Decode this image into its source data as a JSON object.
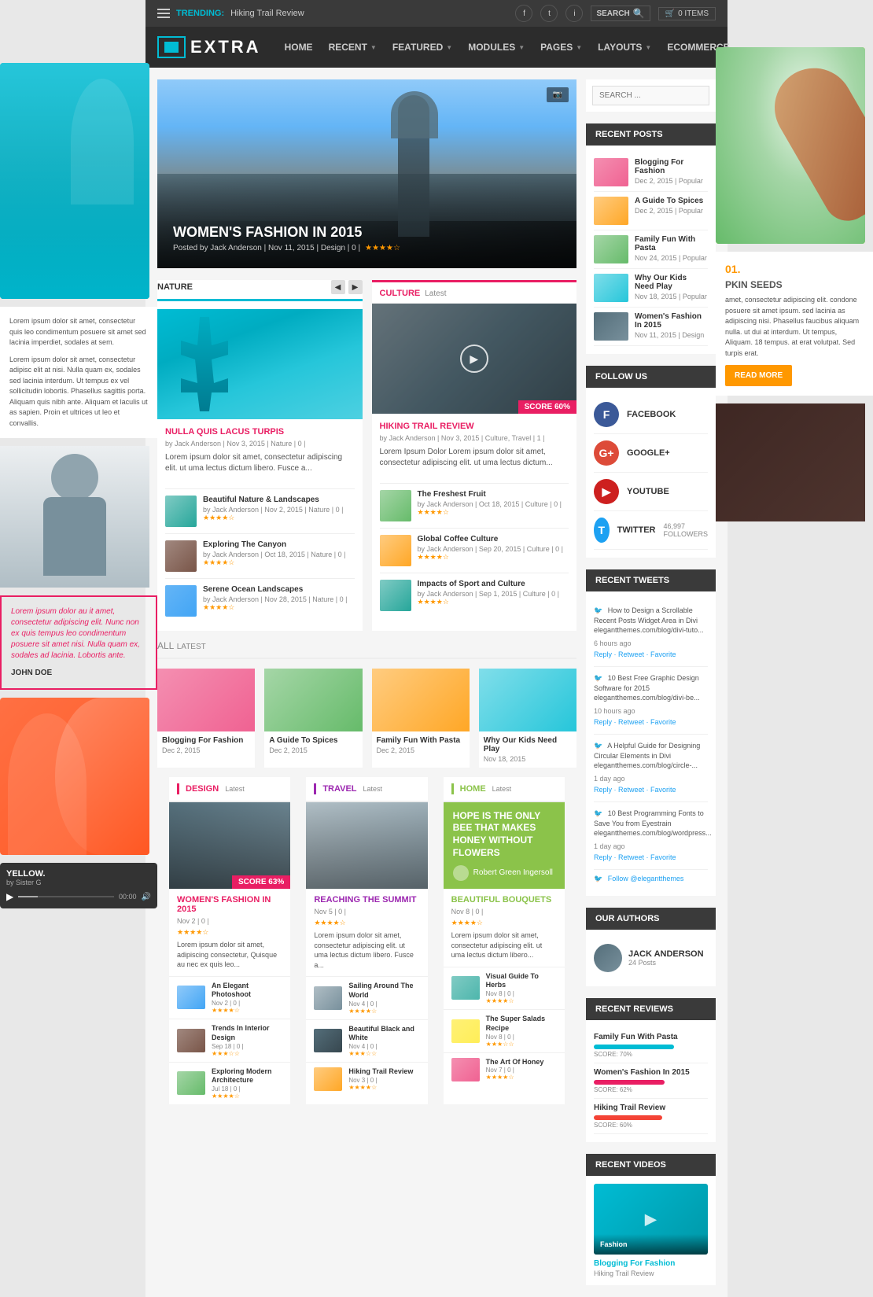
{
  "topbar": {
    "trending_label": "TRENDING:",
    "trending_text": "Hiking Trail Review",
    "search_placeholder": "Search",
    "search_label": "SEARCH",
    "cart_label": "0 ITEMS"
  },
  "nav": {
    "logo_text": "EXTRA",
    "menu_items": [
      "HOME",
      "RECENT",
      "FEATURED",
      "MODULES",
      "PAGES",
      "LAYOUTS",
      "ECOMMERCE"
    ]
  },
  "hero": {
    "title": "WOMEN'S FASHION IN 2015",
    "meta": "Posted by Jack Anderson | Nov 11, 2015 | Design | 0 |",
    "camera_icon": "📷"
  },
  "nature_section": {
    "title": "NATURE",
    "subtitle": "",
    "post_title": "NULLA QUIS LACUS TURPIS",
    "post_meta": "by Jack Anderson | Nov 3, 2015 | Nature | 0 |",
    "post_text": "Lorem ipsum dolor sit amet, consectetur adipiscing elit. ut uma lectus dictum libero. Fusce a...",
    "small_posts": [
      {
        "title": "Beautiful Nature & Landscapes",
        "meta": "by Jack Anderson | Nov 2, 2015 | Nature | 0 |"
      },
      {
        "title": "Exploring The Canyon",
        "meta": "by Jack Anderson | Oct 18, 2015 | Nature | 0 |"
      },
      {
        "title": "Serene Ocean Landscapes",
        "meta": "by Jack Anderson | Nov 28, 2015 | Nature | 0 |"
      }
    ]
  },
  "culture_section": {
    "title": "CULTURE",
    "subtitle": "Latest",
    "post_title": "HIKING TRAIL REVIEW",
    "post_meta": "by Jack Anderson | Nov 3, 2015 | Culture, Travel | 1 |",
    "post_text": "Lorem Ipsum Dolor Lorem ipsum dolor sit amet, consectetur adipiscing elit. ut uma lectus dictum...",
    "score": "SCORE 60%",
    "small_posts": [
      {
        "title": "The Freshest Fruit",
        "meta": "by Jack Anderson | Oct 18, 2015 | Culture | 0 |"
      },
      {
        "title": "Global Coffee Culture",
        "meta": "by Jack Anderson | Sep 20, 2015 | Culture | 0 |"
      },
      {
        "title": "Impacts of Sport and Culture",
        "meta": "by Jack Anderson | Sep 1, 2015 | Culture | 0 |"
      }
    ]
  },
  "all_latest": {
    "title": "ALL",
    "subtitle": "Latest",
    "posts": [
      {
        "title": "Blogging For Fashion",
        "date": "Dec 2, 2015"
      },
      {
        "title": "A Guide To Spices",
        "date": "Dec 2, 2015"
      },
      {
        "title": "Family Fun With Pasta",
        "date": "Dec 2, 2015"
      },
      {
        "title": "Why Our Kids Need Play",
        "date": "Nov 18, 2015"
      }
    ]
  },
  "design_section": {
    "title": "DESIGN",
    "subtitle": "Latest",
    "score": "SCORE 63%",
    "post_title": "WOMEN'S FASHION IN 2015",
    "post_meta": "Nov 2 | 0 |",
    "post_text": "Lorem ipsum dolor sit amet, adipiscing consectetur, Quisque au nec ex quis leo...",
    "small_posts": [
      {
        "title": "An Elegant Photoshoot",
        "meta": "Nov 2 | 0 |"
      },
      {
        "title": "Trends In Interior Design",
        "meta": "Sep 18 | 0 |"
      },
      {
        "title": "Exploring Modern Architecture",
        "meta": "Jul 18 | 0 |"
      }
    ]
  },
  "travel_section": {
    "title": "TRAVEL",
    "subtitle": "Latest",
    "post_title": "REACHING THE SUMMIT",
    "post_meta": "Nov 5 | 0 |",
    "post_text": "Lorem ipsum dolor sit amet, consectetur adipiscing elit. ut uma lectus dictum libero. Fusce a...",
    "small_posts": [
      {
        "title": "Sailing Around The World",
        "meta": "Nov 4 | 0 |"
      },
      {
        "title": "Beautiful Black and White",
        "meta": "Nov 4 | 0 |"
      },
      {
        "title": "Hiking Trail Review",
        "meta": "Nov 3 | 0 |"
      }
    ]
  },
  "home_section": {
    "title": "HOME",
    "subtitle": "Latest",
    "quote": "HOPE IS THE ONLY BEE THAT MAKES HONEY WITHOUT FLOWERS",
    "author": "Robert Green Ingersoll",
    "post_title": "BEAUTIFUL BOUQUETS",
    "post_meta": "Nov 8 | 0 |",
    "post_text": "Lorem ipsum dolor sit amet, consectetur adipiscing elit. ut uma lectus dictum libero...",
    "small_posts": [
      {
        "title": "Visual Guide To Herbs",
        "meta": "Nov 8 | 0 |"
      },
      {
        "title": "The Super Salads Recipe",
        "meta": "Nov 8 | 0 |"
      },
      {
        "title": "The Art Of Honey",
        "meta": "Nov 7 | 0 |"
      }
    ]
  },
  "sidebar": {
    "search_placeholder": "SEARCH ...",
    "recent_posts_title": "RECENT POSTS",
    "recent_posts": [
      {
        "title": "Blogging For Fashion",
        "meta": "Dec 2, 2015 | Popular"
      },
      {
        "title": "A Guide To Spices",
        "meta": "Dec 2, 2015 | Popular"
      },
      {
        "title": "Family Fun With Pasta",
        "meta": "Nov 24, 2015 | Popular"
      },
      {
        "title": "Why Our Kids Need Play",
        "meta": "Nov 18, 2015 | Popular"
      },
      {
        "title": "Women's Fashion In 2015",
        "meta": "Nov 11, 2015 | Design"
      }
    ],
    "follow_us_title": "FOLLOW US",
    "follow_items": [
      {
        "platform": "FACEBOOK",
        "icon": "f"
      },
      {
        "platform": "GOOGLE+",
        "icon": "g"
      },
      {
        "platform": "YOUTUBE",
        "icon": "▶"
      },
      {
        "platform": "TWITTER",
        "count": "46,997 followers",
        "icon": "t"
      }
    ],
    "recent_tweets_title": "RECENT TWEETS",
    "tweets": [
      {
        "text": "How to Design a Scrollable Recent Posts Widget Area in Divi elegantthemes.com/blog/divi-tuto...",
        "time": "6 hours ago",
        "actions": "Reply · Retweet · Favorite"
      },
      {
        "text": "10 Best Free Graphic Design Software for 2015 elegantthemes.com/blog/divi-be...",
        "time": "10 hours ago",
        "actions": "Reply · Retweet · Favorite"
      },
      {
        "text": "A Helpful Guide for Designing Circular Elements in Divi elegantthemes.com/blog/circle-...",
        "time": "1 day ago",
        "actions": "Reply · Retweet · Favorite"
      },
      {
        "text": "10 Best Programming Fonts to Save You from Eyestrain elegantthemes.com/blog/wordpress...",
        "time": "1 day ago",
        "actions": "Reply · Retweet · Favorite"
      },
      {
        "text": "Follow @elegantthemes",
        "time": "",
        "actions": ""
      }
    ],
    "authors_title": "OUR AUTHORS",
    "authors": [
      {
        "name": "JACK ANDERSON",
        "posts": "24 Posts"
      }
    ],
    "reviews_title": "RECENT REVIEWS",
    "reviews": [
      {
        "title": "Family Fun With Pasta",
        "score": "SCORE: 70%",
        "bar_class": "score-bar-teal"
      },
      {
        "title": "Women's Fashion In 2015",
        "score": "SCORE: 62%",
        "bar_class": "score-bar-pink"
      },
      {
        "title": "Hiking Trail Review",
        "score": "SCORE: 60%",
        "bar_class": "score-bar-red"
      }
    ],
    "videos_title": "RECENT VIDEOS",
    "video": {
      "title": "Blogging For Fashion",
      "subtitle": "Hiking Trail Review"
    }
  },
  "left_decorative": {
    "lorem_text": "Lorem ipsum dolor sit amet, consectetur quis leo condimentum posuere sit amet sed lacinia imperdiet, sodales at sem.",
    "lorem_text2": "Lorem ipsum dolor sit amet, consectetur adipisc elit at nisi. Nulla quam ex, sodales sed lacinia interdum. Ut tempus ex vel sollicitudin lobortis. Phasellus sagittis porta. Aliquam quis nibh ante. Aliquam et laculis ut as sapien. Proin et ultrices ut leo et convallis.",
    "quote": "Lorem ipsum dolor au it amet, consectetur adipiscing elit. Nunc non ex quis tempus leo condimentum posuere sit amet nisi. Nulla quam ex, sodales ad lacinia. Lobortis ante.",
    "quote_author": "JOHN DOE",
    "player_title": "YELLOW.",
    "player_author": "by Sister G",
    "player_time": "00:00"
  },
  "right_decorative": {
    "seed_number": "01.",
    "seed_title": "PKIN SEEDS",
    "seed_text": "amet, consectetur adipiscing elit. condone posuere sit amet ipsum. sed lacinia as adipiscing nisi. Phasellus faucibus aliquam nulla. ut dui at interdum. Ut tempus, Aliquam. 18 tempus. at erat volutpat. Sed turpis erat.",
    "read_more": "READ MORE"
  }
}
